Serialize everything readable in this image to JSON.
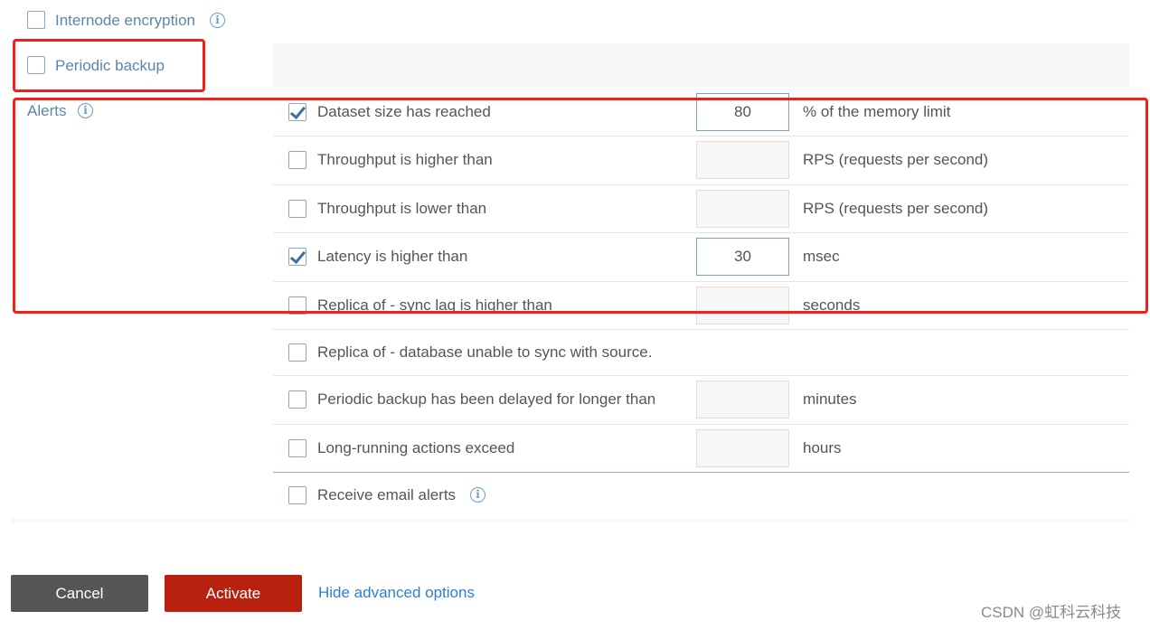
{
  "options": {
    "internode_encryption": {
      "label": "Internode encryption",
      "checked": false
    },
    "periodic_backup": {
      "label": "Periodic backup",
      "checked": false
    }
  },
  "alerts": {
    "label": "Alerts",
    "rows": [
      {
        "label": "Dataset size has reached",
        "checked": true,
        "value": "80",
        "unit": "% of the memory limit"
      },
      {
        "label": "Throughput is higher than",
        "checked": false,
        "value": "",
        "unit": "RPS (requests per second)"
      },
      {
        "label": "Throughput is lower than",
        "checked": false,
        "value": "",
        "unit": "RPS (requests per second)"
      },
      {
        "label": "Latency is higher than",
        "checked": true,
        "value": "30",
        "unit": "msec"
      },
      {
        "label": "Replica of - sync lag is higher than",
        "checked": false,
        "value": "",
        "unit": "seconds"
      },
      {
        "label": "Replica of - database unable to sync with source.",
        "checked": false
      },
      {
        "label": "Periodic backup has been delayed for longer than",
        "checked": false,
        "value": "",
        "unit": "minutes"
      },
      {
        "label": "Long-running actions exceed",
        "checked": false,
        "value": "",
        "unit": "hours"
      }
    ],
    "email": {
      "label": "Receive email alerts",
      "checked": false
    }
  },
  "footer": {
    "cancel_label": "Cancel",
    "activate_label": "Activate",
    "hide_advanced_label": "Hide advanced options"
  },
  "watermark": "CSDN @虹科云科技",
  "colors": {
    "cancel_button": "#555555",
    "activate_button": "#b8200f",
    "link": "#2f7fd1",
    "highlight_box": "#f0201a",
    "label_blue": "#5c86a8"
  }
}
